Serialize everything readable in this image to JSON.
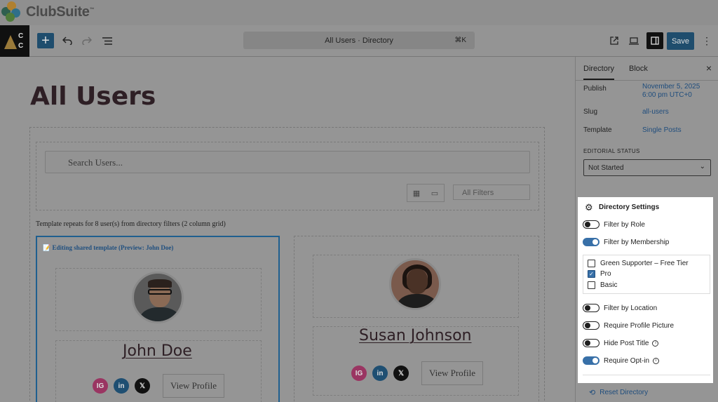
{
  "brand": {
    "name": "ClubSuite",
    "tm": "™"
  },
  "site_icon": {
    "letter_top": "C",
    "letter_bottom": "C"
  },
  "toolbar": {
    "add_label": "+",
    "undo_icon": "undo-icon",
    "redo_icon": "redo-icon",
    "list_view_icon": "list-view-icon",
    "document_title": "All Users · Directory",
    "command_shortcut": "⌘K",
    "save_label": "Save"
  },
  "page": {
    "title": "All Users"
  },
  "directory": {
    "search_placeholder": "Search Users...",
    "all_filters_label": "All Filters",
    "repeat_note": "Template repeats for 8 user(s) from directory filters (2 column grid)",
    "editing_label": "📝 Editing shared template (Preview: John Doe)",
    "users": [
      {
        "name": "John Doe",
        "view_profile": "View Profile"
      },
      {
        "name": "Susan Johnson",
        "view_profile": "View Profile"
      }
    ],
    "social": {
      "instagram": "IG",
      "linkedin": "in",
      "x": "𝕏"
    }
  },
  "sidebar": {
    "tabs": [
      {
        "label": "Directory"
      },
      {
        "label": "Block"
      }
    ],
    "close_label": "×",
    "publish_label": "Publish",
    "publish_value_line1": "November 5, 2025",
    "publish_value_line2": "6:00 pm UTC+0",
    "slug_label": "Slug",
    "slug_value": "all-users",
    "template_label": "Template",
    "template_value": "Single Posts",
    "editorial_status_label": "EDITORIAL STATUS",
    "editorial_status_value": "Not Started"
  },
  "settings": {
    "title": "Directory Settings",
    "filter_by_role": "Filter by Role",
    "filter_by_membership": "Filter by Membership",
    "tiers": [
      {
        "label": "Green Supporter – Free Tier",
        "checked": false
      },
      {
        "label": "Pro",
        "checked": true
      },
      {
        "label": "Basic",
        "checked": false
      }
    ],
    "filter_by_location": "Filter by Location",
    "require_profile_picture": "Require Profile Picture",
    "hide_post_title": "Hide Post Title",
    "require_opt_in": "Require Opt-in",
    "toggles": {
      "filter_by_role": false,
      "filter_by_membership": true,
      "filter_by_location": false,
      "require_profile_picture": false,
      "hide_post_title": false,
      "require_opt_in": true
    },
    "reset_label": "Reset Directory"
  },
  "colors": {
    "accent": "#3870a8",
    "save": "#1f4d6d",
    "link": "#1f4d7d"
  }
}
